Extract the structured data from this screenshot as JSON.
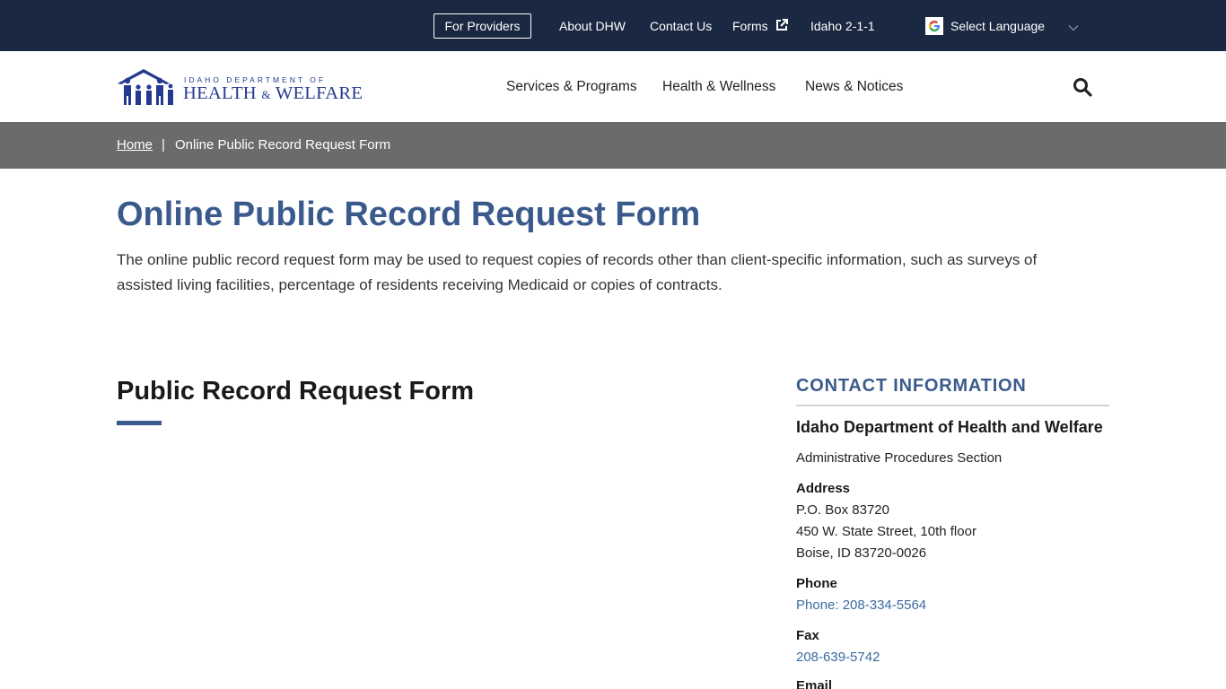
{
  "topbar": {
    "providers_label": "For Providers",
    "links": [
      "About DHW",
      "Contact Us",
      "Forms",
      "Idaho 2-1-1"
    ],
    "language_label": "Select Language"
  },
  "header": {
    "logo_small": "IDAHO DEPARTMENT OF",
    "logo_main_1": "HEALTH",
    "logo_amp": "&",
    "logo_main_2": "WELFARE",
    "nav": [
      "Services & Programs",
      "Health & Wellness",
      "News & Notices"
    ]
  },
  "breadcrumb": {
    "home": "Home",
    "separator": "|",
    "current": "Online Public Record Request Form"
  },
  "main": {
    "title": "Online Public Record Request Form",
    "intro": "The online public record request form may be used to request copies of records other than client-specific information, such as surveys of assisted living facilities, percentage of residents receiving Medicaid or copies of contracts.",
    "section_title": "Public Record Request Form"
  },
  "sidebar": {
    "heading": "CONTACT INFORMATION",
    "org": "Idaho Department of Health and Welfare",
    "sub": "Administrative Procedures Section",
    "address_label": "Address",
    "address_lines": [
      "P.O. Box 83720",
      "450 W. State Street, 10th floor",
      "Boise, ID 83720-0026"
    ],
    "phone_label": "Phone",
    "phone": "Phone: 208-334-5564",
    "fax_label": "Fax",
    "fax": "208-639-5742",
    "email_label": "Email"
  },
  "colors": {
    "topbar": "#1b2842",
    "breadcrumb_bar": "#6b6b6b",
    "accent": "#3b5a8c",
    "logo_blue": "#233a8f",
    "link": "#3b6aa0"
  },
  "icons": [
    "external-link-icon",
    "google-g-icon",
    "chevron-down-icon",
    "search-icon",
    "family-logo-icon"
  ]
}
